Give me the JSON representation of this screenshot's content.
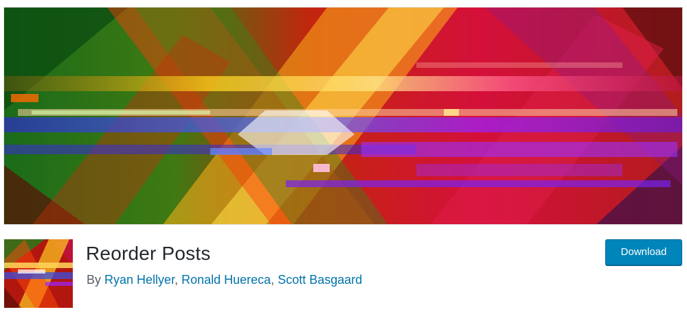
{
  "plugin": {
    "name": "Reorder Posts",
    "by_prefix": "By",
    "authors": [
      "Ryan Hellyer",
      "Ronald Huereca",
      "Scott Basgaard"
    ],
    "separator": ", "
  },
  "actions": {
    "download_label": "Download"
  },
  "colors": {
    "button_bg": "#0085ba",
    "link": "#0073aa",
    "title": "#23282d"
  }
}
